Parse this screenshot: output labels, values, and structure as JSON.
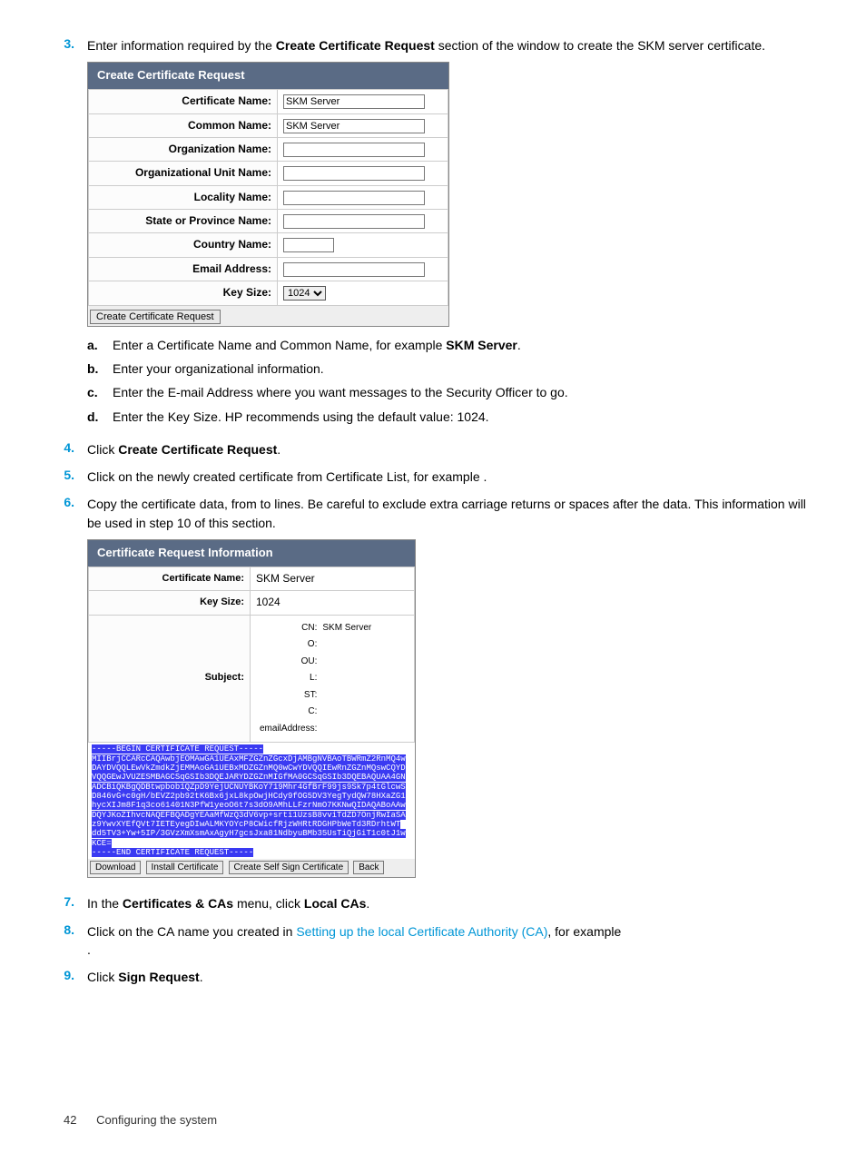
{
  "steps": {
    "3": {
      "text_before": "Enter information required by the ",
      "bold1": "Create Certificate Request",
      "text_after": " section of the window to create the SKM server certificate.",
      "sub": {
        "a": {
          "text_before": "Enter a Certificate Name and Common Name, for example ",
          "bold": "SKM Server",
          "text_after": "."
        },
        "b": {
          "text": "Enter your organizational information."
        },
        "c": {
          "text": "Enter the E-mail Address where you want messages to the Security Officer to go."
        },
        "d": {
          "text": "Enter the Key Size. HP recommends using the default value: 1024."
        }
      }
    },
    "4": {
      "before": "Click ",
      "bold": "Create Certificate Request",
      "after": "."
    },
    "5": {
      "before": "Click on the newly created certificate from Certificate List, for example ",
      "after": "."
    },
    "6": {
      "before": "Copy the certificate data, from ",
      "mid": " to ",
      "after": " lines. Be careful to exclude extra carriage returns or spaces after the data. This information will be used in step 10 of this section."
    },
    "7": {
      "before": "In the ",
      "bold1": "Certificates & CAs",
      "mid": " menu, click ",
      "bold2": "Local CAs",
      "after": "."
    },
    "8": {
      "before": "Click on the CA name you created in ",
      "link": "Setting up the local Certificate Authority (CA)",
      "after": ", for example ",
      "tail": "."
    },
    "9": {
      "before": "Click ",
      "bold": "Sign Request",
      "after": "."
    }
  },
  "form": {
    "header": "Create Certificate Request",
    "fields": {
      "certificate_name": {
        "label": "Certificate Name:",
        "value": "SKM Server"
      },
      "common_name": {
        "label": "Common Name:",
        "value": "SKM Server"
      },
      "organization_name": {
        "label": "Organization Name:",
        "value": ""
      },
      "ou_name": {
        "label": "Organizational Unit Name:",
        "value": ""
      },
      "locality_name": {
        "label": "Locality Name:",
        "value": ""
      },
      "state_name": {
        "label": "State or Province Name:",
        "value": ""
      },
      "country_name": {
        "label": "Country Name:",
        "value": ""
      },
      "email": {
        "label": "Email Address:",
        "value": ""
      },
      "key_size": {
        "label": "Key Size:",
        "value": "1024"
      }
    },
    "submit": "Create Certificate Request"
  },
  "info": {
    "header": "Certificate Request Information",
    "certificate_name": {
      "label": "Certificate Name:",
      "value": "SKM Server"
    },
    "key_size": {
      "label": "Key Size:",
      "value": "1024"
    },
    "subject_label": "Subject:",
    "subject": {
      "CN": "SKM Server",
      "O": "",
      "OU": "",
      "L": "",
      "ST": "",
      "C": "",
      "emailAddress": ""
    },
    "cert_text": "-----BEGIN CERTIFICATE REQUEST-----\nMIIBrjCCARcCAQAwbjEOMAwGA1UEAxMFZGZnZGcxDjAMBgNVBAoTBWRmZ2RnMQ4w\nDAYDVQQLEwVkZmdkZjEMMAoGA1UEBxMDZGZnMQ0wCwYDVQQIEwRnZGZnMQswCQYD\nVQQGEwJVUZESMBAGCSqGSIb3DQEJARYDZGZnMIGfMA0GCSqGSIb3DQEBAQUAA4GN\nADCBiQKBgQDBtwpbob1QZpD9YejUCNUYBKoY719Mhr4GfBrF99js9Sk7p4tGlcwS\nD846vG+c0gH/bEVZ2pb92tK6Bx6jxL8kpOwjHCdy9fOG5DV3YegTydQW78HXaZG1\nhycXIJm8F1q3co61401N3PfW1yeoO6t7s3dO9AMhLLFzrNmO7KKNwQIDAQABoAAw\nDQYJKoZIhvcNAQEFBQADgYEAaMfWzQ3dV6vp+srti1UzsB8vviTdZD7OnjRwIaSA\nz9YwvXYEfQVt7IETEyegDIwALMKYOYcP8CWicfRjzWHRtRDGHPbWeTd3RDrhtWT\ndd5TV3+Yw+5IP/3GVzXmXsmAxAgyH7gcsJxa81NdbyuBMb35UsTiQjGiT1c0tJ1w\nKCE=\n-----END CERTIFICATE REQUEST-----",
    "buttons": {
      "download": "Download",
      "install": "Install Certificate",
      "self_sign": "Create Self Sign Certificate",
      "back": "Back"
    }
  },
  "footer": {
    "page_num": "42",
    "title": "Configuring the system"
  }
}
